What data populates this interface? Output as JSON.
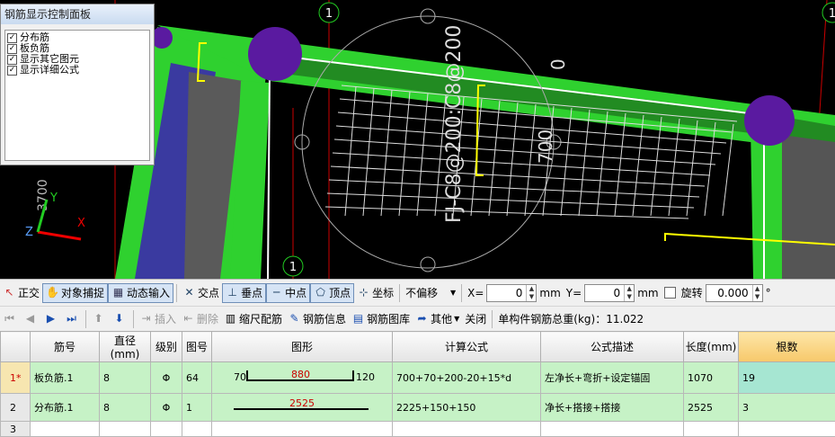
{
  "viewport": {
    "axis_markers": [
      "1",
      "1",
      "1"
    ],
    "rebar_label": "FJ-C8@200:C8@200",
    "dim_700": "700",
    "dim_0": "0",
    "dim_left": "3700",
    "axis_y": "Y",
    "axis_x": "X",
    "axis_z": "Z"
  },
  "control_panel": {
    "title": "钢筋显示控制面板",
    "items": [
      {
        "label": "分布筋",
        "checked": true
      },
      {
        "label": "板负筋",
        "checked": true
      },
      {
        "label": "显示其它图元",
        "checked": true
      },
      {
        "label": "显示详细公式",
        "checked": true
      }
    ]
  },
  "toolbar1": {
    "ortho": "正交",
    "snap": "对象捕捉",
    "dynamic": "动态输入",
    "intersection": "交点",
    "perpendicular": "垂点",
    "midpoint": "中点",
    "vertex": "顶点",
    "coordinate": "坐标",
    "offset_select": "不偏移",
    "x_label": "X=",
    "x_value": "0",
    "x_unit": "mm",
    "y_label": "Y=",
    "y_value": "0",
    "y_unit": "mm",
    "rotate_label": "旋转",
    "rotate_value": "0.000",
    "rotate_unit": "°"
  },
  "toolbar2": {
    "insert": "插入",
    "delete": "删除",
    "scale_rebar": "缩尺配筋",
    "rebar_info": "钢筋信息",
    "rebar_library": "钢筋图库",
    "other": "其他",
    "close": "关闭",
    "total_weight": "单构件钢筋总重(kg)：11.022"
  },
  "table": {
    "headers": [
      "",
      "筋号",
      "直径(mm)",
      "级别",
      "图号",
      "图形",
      "计算公式",
      "公式描述",
      "长度(mm)",
      "根数"
    ],
    "rows": [
      {
        "no": "1*",
        "name": "板负筋.1",
        "diameter": "8",
        "grade": "Φ",
        "fig_no": "64",
        "shape_left": "70",
        "shape_mid": "880",
        "shape_right": "120",
        "formula": "700+70+200-20+15*d",
        "desc": "左净长+弯折+设定锚固",
        "length": "1070",
        "count": "19"
      },
      {
        "no": "2",
        "name": "分布筋.1",
        "diameter": "8",
        "grade": "Φ",
        "fig_no": "1",
        "shape_mid": "2525",
        "formula": "2225+150+150",
        "desc": "净长+搭接+搭接",
        "length": "2525",
        "count": "3"
      },
      {
        "no": "3"
      }
    ]
  },
  "colors": {
    "slab_green": "#2ecc2e",
    "purple": "#5a1aa0",
    "rebar_yellow": "#ffff00",
    "selected_row": "#c6f2c6",
    "count_header": "#f7c86a"
  }
}
